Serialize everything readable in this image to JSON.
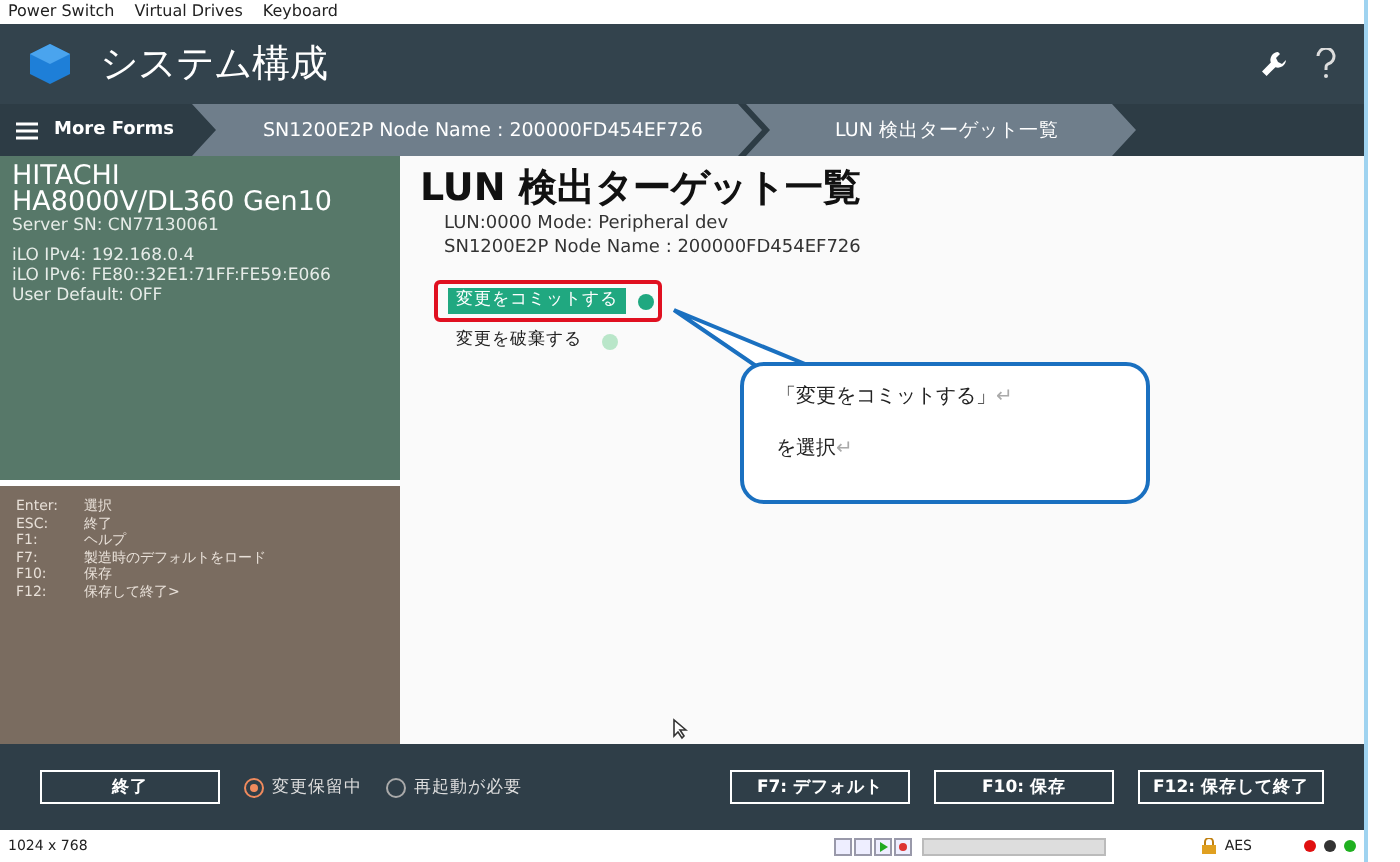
{
  "menu_bar": [
    "Power Switch",
    "Virtual Drives",
    "Keyboard"
  ],
  "header": {
    "title": "システム構成"
  },
  "breadcrumb": {
    "menu": "More Forms",
    "items": [
      "SN1200E2P Node Name : 200000FD454EF726",
      "LUN 検出ターゲット一覧"
    ]
  },
  "system_info": {
    "vendor": "HITACHI",
    "model": "HA8000V/DL360 Gen10",
    "serial": "Server SN: CN77130061",
    "details": [
      "iLO IPv4: 192.168.0.4",
      "iLO IPv6: FE80::32E1:71FF:FE59:E066",
      "User Default: OFF"
    ]
  },
  "key_help": [
    {
      "key": "Enter:",
      "action": "選択"
    },
    {
      "key": "ESC:",
      "action": "終了"
    },
    {
      "key": "F1:",
      "action": "ヘルプ"
    },
    {
      "key": "F7:",
      "action": "製造時のデフォルトをロード"
    },
    {
      "key": "F10:",
      "action": "保存"
    },
    {
      "key": "F12:",
      "action": "保存して終了>"
    }
  ],
  "content": {
    "title": "LUN 検出ターゲット一覧",
    "info": [
      "LUN:0000 Mode: Peripheral dev",
      "SN1200E2P Node Name : 200000FD454EF726"
    ],
    "actions": [
      {
        "label": "変更をコミットする",
        "selected": true
      },
      {
        "label": "変更を破棄する",
        "selected": false
      }
    ]
  },
  "callout": {
    "lines": [
      {
        "text": "「変更をコミットする」",
        "mark": "↵"
      },
      {
        "text": "を選択",
        "mark": "↵"
      }
    ]
  },
  "footer": {
    "exit": "終了",
    "radios": [
      {
        "label": "変更保留中",
        "selected": true
      },
      {
        "label": "再起動が必要",
        "selected": false
      }
    ],
    "buttons": [
      "F7: デフォルト",
      "F10: 保存",
      "F12: 保存して終了"
    ]
  },
  "status_bar": {
    "resolution": "1024 x 768",
    "progress": {
      "level": 0
    },
    "encryption": "AES",
    "lights": [
      {
        "color": "#e01010"
      },
      {
        "color": "#333333"
      },
      {
        "color": "#20b020"
      }
    ]
  }
}
